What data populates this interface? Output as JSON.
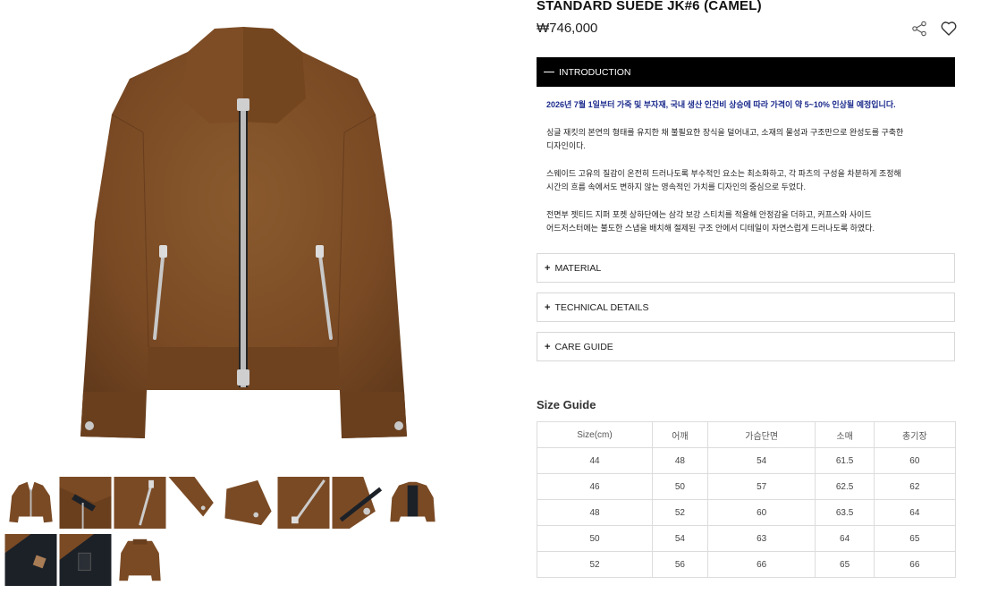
{
  "product": {
    "title": "STANDARD SUEDE JK#6 (CAMEL)",
    "price": "₩746,000",
    "colors": {
      "suede": "#7a4a24",
      "suede_dark": "#5a3418",
      "lining": "#1c2128",
      "zipper": "#b9b9b9"
    }
  },
  "actions": {
    "share_icon": "share-icon",
    "wishlist_icon": "heart-icon"
  },
  "intro": {
    "label": "INTRODUCTION",
    "notice": "2026년 7월 1일부터 가죽 및 부자재, 국내 생산 인건비 상승에 따라 가격이 약 5~10% 인상될 예정입니다.",
    "p1a": "싱글 재킷의 본연의 형태를 유지한 채 불필요한 장식을 덜어내고, 소재의 물성과 구조만으로 완성도를 구축한",
    "p1b": "디자인이다.",
    "p2a": "스웨이드 고유의 질감이 온전히 드러나도록 부수적인 요소는 최소화하고, 각 파츠의 구성을 차분하게 조정해",
    "p2b": "시간의 흐름 속에서도 변하지 않는 영속적인 가치를 디자인의 중심으로 두었다.",
    "p3a": "전면부 젯티드 지퍼 포켓 상하단에는 삼각 보강 스티치를 적용해 안정감을 더하고, 커프스와 사이드",
    "p3b": "어드저스터에는 불도한 스냅을 배치해 절제된 구조 안에서 디테일이 자연스럽게 드러나도록 하였다."
  },
  "accordions": {
    "plus": "+",
    "material": "MATERIAL",
    "technical": "TECHNICAL DETAILS",
    "care": "CARE GUIDE"
  },
  "size_guide": {
    "title": "Size Guide",
    "headers": [
      "Size(cm)",
      "어깨",
      "가슴단면",
      "소매",
      "총기장"
    ],
    "rows": [
      [
        "44",
        "48",
        "54",
        "61.5",
        "60"
      ],
      [
        "46",
        "50",
        "57",
        "62.5",
        "62"
      ],
      [
        "48",
        "52",
        "60",
        "63.5",
        "64"
      ],
      [
        "50",
        "54",
        "63",
        "64",
        "65"
      ],
      [
        "52",
        "56",
        "66",
        "65",
        "66"
      ]
    ]
  }
}
